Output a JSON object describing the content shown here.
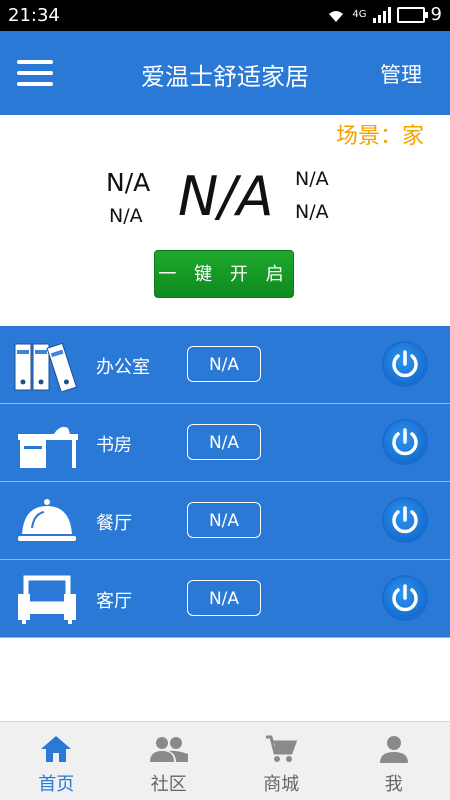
{
  "status_bar": {
    "time": "21:34",
    "network": "4G",
    "battery": "9"
  },
  "header": {
    "title": "爱温士舒适家居",
    "manage_label": "管理"
  },
  "scene": {
    "label": "场景：家"
  },
  "sensors": {
    "left_top": "N/A",
    "left_bottom": "N/A",
    "main": "N/A",
    "right_top": "N/A",
    "right_bottom": "N/A"
  },
  "one_key_button": "一 键 开 启",
  "rooms": [
    {
      "name": "办公室",
      "value": "N/A",
      "icon": "binders-icon"
    },
    {
      "name": "书房",
      "value": "N/A",
      "icon": "desk-icon"
    },
    {
      "name": "餐厅",
      "value": "N/A",
      "icon": "service-bell-icon"
    },
    {
      "name": "客厅",
      "value": "N/A",
      "icon": "armchair-icon"
    }
  ],
  "tabs": [
    {
      "label": "首页",
      "icon": "home-icon",
      "active": true
    },
    {
      "label": "社区",
      "icon": "people-icon",
      "active": false
    },
    {
      "label": "商城",
      "icon": "cart-icon",
      "active": false
    },
    {
      "label": "我",
      "icon": "user-icon",
      "active": false
    }
  ],
  "colors": {
    "accent": "#2a79d6",
    "scene": "#f4a200",
    "button": "#1ea92c"
  }
}
